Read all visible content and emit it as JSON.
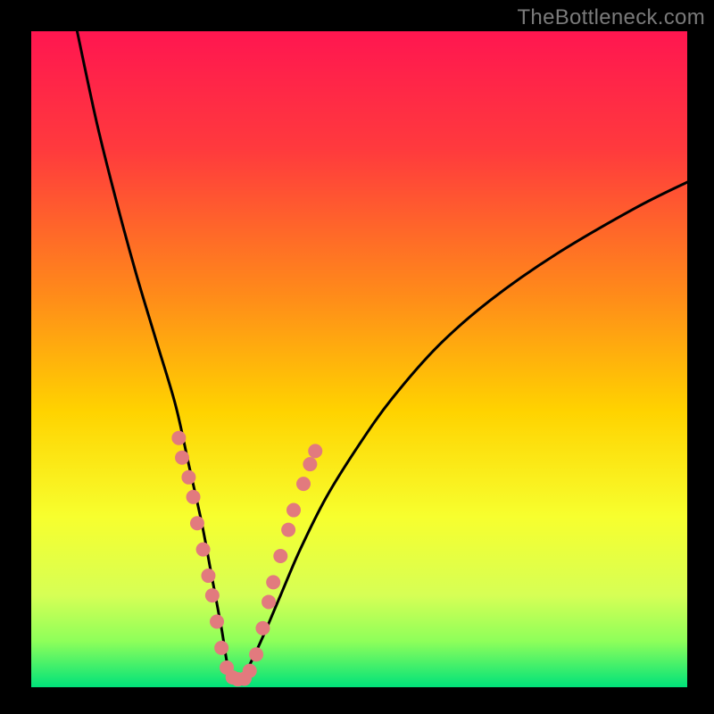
{
  "watermark": "TheBottleneck.com",
  "chart_data": {
    "type": "line",
    "title": "",
    "xlabel": "",
    "ylabel": "",
    "xlim": [
      0,
      100
    ],
    "ylim": [
      0,
      100
    ],
    "gradient_stops": [
      {
        "pos": 0.0,
        "color": "#ff1650"
      },
      {
        "pos": 0.18,
        "color": "#ff3a3d"
      },
      {
        "pos": 0.4,
        "color": "#ff8a1a"
      },
      {
        "pos": 0.58,
        "color": "#ffd300"
      },
      {
        "pos": 0.74,
        "color": "#f7ff2e"
      },
      {
        "pos": 0.86,
        "color": "#d6ff55"
      },
      {
        "pos": 0.93,
        "color": "#8eff5a"
      },
      {
        "pos": 1.0,
        "color": "#00e27a"
      }
    ],
    "series": [
      {
        "name": "bottleneck-curve",
        "x": [
          7,
          10,
          13,
          16,
          19,
          22,
          24,
          26,
          27.5,
          29,
          30,
          31,
          32.5,
          35,
          38,
          41,
          45,
          50,
          55,
          62,
          70,
          80,
          92,
          100
        ],
        "y": [
          100,
          86,
          74,
          63,
          53,
          43,
          34,
          25,
          17,
          9,
          3,
          1,
          2,
          7,
          14,
          21,
          29,
          37,
          44,
          52,
          59,
          66,
          73,
          77
        ]
      }
    ],
    "markers": [
      {
        "x": 22.5,
        "y": 38
      },
      {
        "x": 23.0,
        "y": 35
      },
      {
        "x": 24.0,
        "y": 32
      },
      {
        "x": 24.7,
        "y": 29
      },
      {
        "x": 25.3,
        "y": 25
      },
      {
        "x": 26.2,
        "y": 21
      },
      {
        "x": 27.0,
        "y": 17
      },
      {
        "x": 27.6,
        "y": 14
      },
      {
        "x": 28.3,
        "y": 10
      },
      {
        "x": 29.0,
        "y": 6
      },
      {
        "x": 29.8,
        "y": 3
      },
      {
        "x": 30.7,
        "y": 1.5
      },
      {
        "x": 31.5,
        "y": 1.2
      },
      {
        "x": 32.5,
        "y": 1.3
      },
      {
        "x": 33.3,
        "y": 2.5
      },
      {
        "x": 34.3,
        "y": 5
      },
      {
        "x": 35.3,
        "y": 9
      },
      {
        "x": 36.2,
        "y": 13
      },
      {
        "x": 36.9,
        "y": 16
      },
      {
        "x": 38.0,
        "y": 20
      },
      {
        "x": 39.2,
        "y": 24
      },
      {
        "x": 40.0,
        "y": 27
      },
      {
        "x": 41.5,
        "y": 31
      },
      {
        "x": 42.5,
        "y": 34
      },
      {
        "x": 43.3,
        "y": 36
      }
    ],
    "marker_color": "#e27a7e",
    "curve_color": "#000000"
  }
}
